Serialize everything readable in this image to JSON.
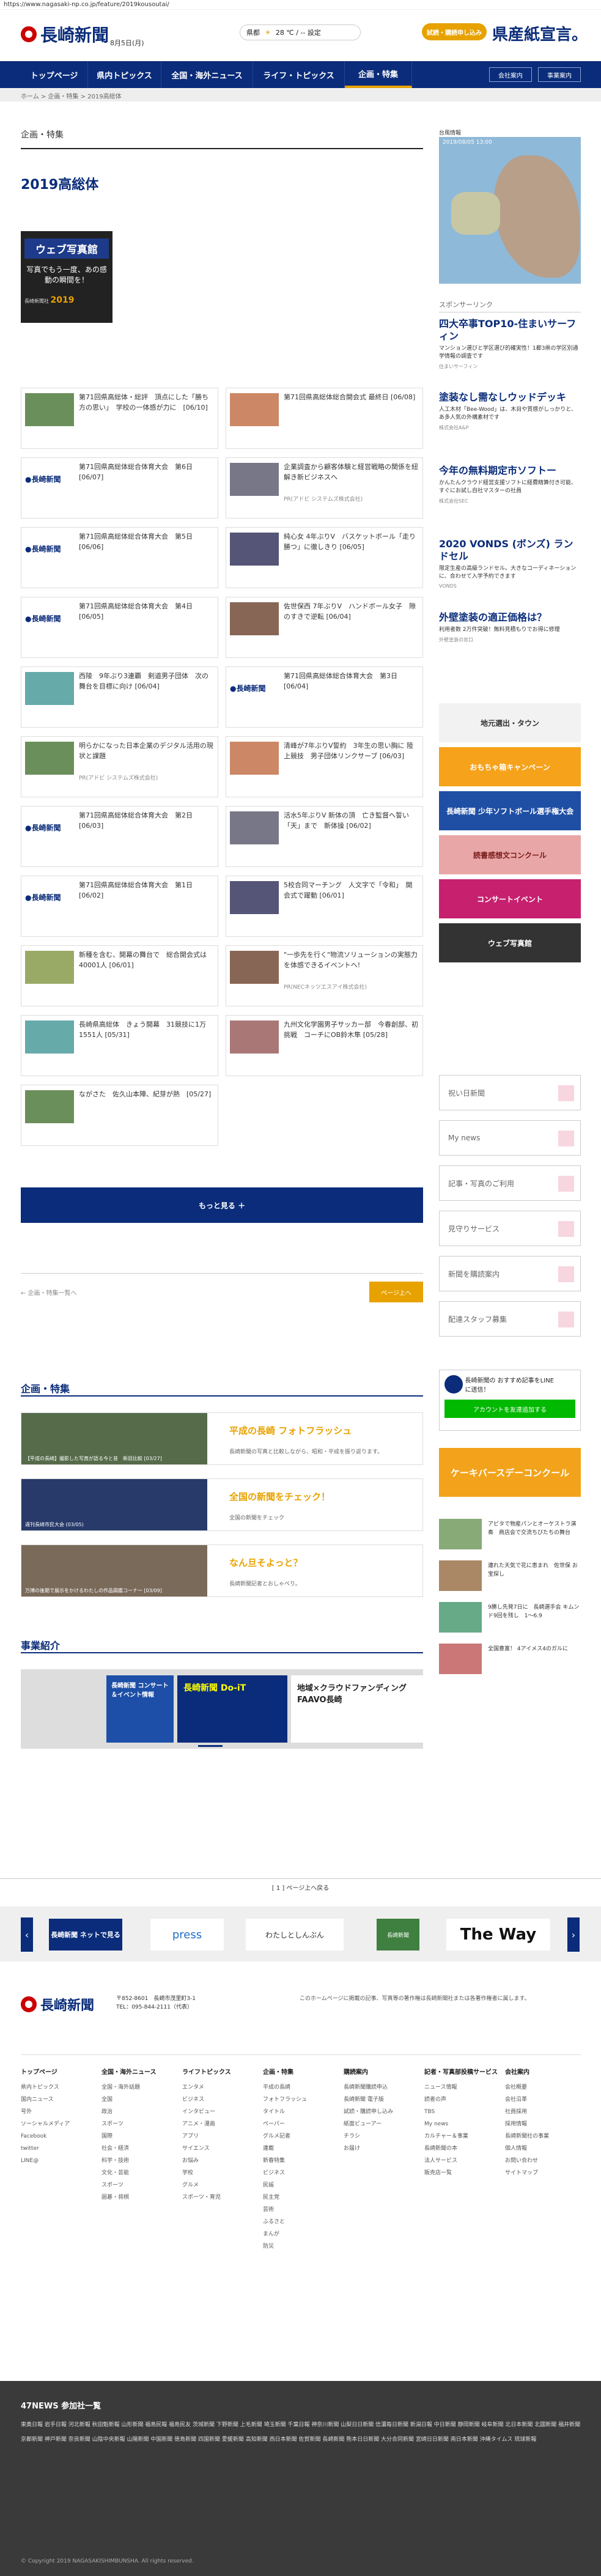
{
  "url": "https://www.nagasaki-np.co.jp/feature/2019kousoutai/",
  "header": {
    "logo": "長崎新聞",
    "date": "8月5日(月)",
    "weather_place": "県都",
    "weather_temp": "28 ℃ / -- 設定",
    "trial": "試読・購読申し込み",
    "slogan": "県産紙宣言。"
  },
  "nav": {
    "items": [
      "トップページ",
      "県内トピックス",
      "全国・海外ニュース",
      "ライフ・トピックス",
      "企画・特集"
    ],
    "company": "会社案内",
    "business": "事業案内"
  },
  "breadcrumb": "ホーム > 企画・特集 > 2019高総体",
  "page": {
    "section": "企画・特集",
    "title": "2019高総体"
  },
  "banner": {
    "title": "ウェブ写真館",
    "sub": "写真でもう一度、あの感動の瞬間を！",
    "year": "2019",
    "brand": "長崎新聞社"
  },
  "articles": [
    {
      "title": "第71回県高総体・総評　頂点にした「勝ち方の思い」　学校の一体感が力に　[06/10]",
      "pr": ""
    },
    {
      "title": "第71回県高総体総合開会式 最終日 [06/08]",
      "pr": ""
    },
    {
      "title": "第71回県高総体総合体育大会　第6日 [06/07]",
      "pr": ""
    },
    {
      "title": "企業調査から顧客体験と経営戦略の関係を紐解き新ビジネスへ",
      "pr": "PR(アドビ システムズ株式会社)"
    },
    {
      "title": "第71回県高総体総合体育大会　第5日 [06/06]",
      "pr": ""
    },
    {
      "title": "純心女 4年ぶりV　バスケットボール「走り勝つ」に徹しきり [06/05]",
      "pr": ""
    },
    {
      "title": "第71回県高総体総合体育大会　第4日 [06/05]",
      "pr": ""
    },
    {
      "title": "佐世保西 7年ぶりV　ハンドボール女子　隙のすきで逆転 [06/04]",
      "pr": ""
    },
    {
      "title": "西陵　9年ぶり3連覇　剣道男子団体　次の舞台を目標に向け [06/04]",
      "pr": ""
    },
    {
      "title": "第71回県高総体総合体育大会　第3日 [06/04]",
      "pr": ""
    },
    {
      "title": "明らかになった日本企業のデジタル活用の現状と課題",
      "pr": "PR(アドビ システムズ株式会社)"
    },
    {
      "title": "清峰が7年ぶりV誓約　3年生の思い胸に 陸上競技　男子団体リンクサーブ [06/03]",
      "pr": ""
    },
    {
      "title": "第71回県高総体総合体育大会　第2日 [06/03]",
      "pr": ""
    },
    {
      "title": "活水5年ぶりV 新体の頂　亡き監督へ誓い「天」まで　新体操 [06/02]",
      "pr": ""
    },
    {
      "title": "第71回県高総体総合体育大会　第1日 [06/02]",
      "pr": ""
    },
    {
      "title": "5校合同マーチング　人文字で「令和」　開会式で躍動 [06/01]",
      "pr": ""
    },
    {
      "title": "新種を含む、開幕の舞台で　総合開会式は40001人 [06/01]",
      "pr": ""
    },
    {
      "title": "\"一歩先を行く\"物流ソリューションの実態力を体感できるイベントへ!",
      "pr": "PR(NECネッツエスアイ株式会社)"
    },
    {
      "title": "長崎県高総体　きょう開幕　31競技に1万1551人 [05/31]",
      "pr": ""
    },
    {
      "title": "九州文化学園男子サッカー部　今春創部、初挑戦　コーチにOB鈴木隼 [05/28]",
      "pr": ""
    },
    {
      "title": "ながさた　佐久山本陣、紀芽が熱　[05/27]",
      "pr": ""
    }
  ],
  "more": "もっと見る ＋",
  "pager": {
    "prev": "← 企画・特集一覧へ",
    "next": "ページ上へ"
  },
  "features_title": "企画・特集",
  "features": [
    {
      "cap": "【平成の長崎】撮影した写真が語る今と昔　新旧比較 [03/27]",
      "title": "平成の長崎 フォトフラッシュ",
      "desc": "長崎新聞の写真と比較しながら、昭和・平成を振り返ります。"
    },
    {
      "cap": "週刊長崎市民大会 (03/05)",
      "title": "全国の新聞をチェック！",
      "desc": "全国の新聞をチェック"
    },
    {
      "cap": "万博の後期で展示をかけるわたしの作品図鑑コーナー [03/09]",
      "title": "なん旦そよっと？",
      "desc": "長崎新聞記者とおしゃべり。"
    }
  ],
  "projects_title": "事業紹介",
  "projects": [
    "長崎新聞 コンサート＆イベント情報",
    "長崎新聞 Do-iT",
    "地域×クラウドファンディング FAAVO長崎"
  ],
  "sidebar": {
    "map_title": "台風情報",
    "map_date": "2019/08/05 13:00",
    "sponsor_label": "スポンサーリンク",
    "sponsors": [
      {
        "h": "四大卒事TOP10-住まいサーフィン",
        "d": "マンション選びと学区選び的確実性！1都3県の学区別通学情報の調査です",
        "s": "住まいサーフィン"
      },
      {
        "h": "塗装なし需なしウッドデッキ",
        "d": "人工木材「Bee-Wood」は、木目や質感がしっかりと、あ多人気の外構素材です",
        "s": "株式会社A&P"
      },
      {
        "h": "今年の無料期定市ソフトー",
        "d": "かんたんクラウド経営支援ソフトに経費精算付き可能、すぐにお試し自社マスターの社員",
        "s": "株式会社SEC"
      },
      {
        "h": "2020 VONDS (ボンズ) ランドセル",
        "d": "限定生産の高級ランドセル。大きなコーディネーションに、合わせて入学予約できます",
        "s": "VONDS"
      },
      {
        "h": "外壁塗装の適正価格は？",
        "d": "利用者数 2万件突破！無料見積もりでお得に修理",
        "s": "外壁塗装の窓口"
      }
    ],
    "promos": [
      "地元選出・タウン",
      "おもちゃ箱キャンペーン",
      "長崎新聞 少年ソフトボール選手権大会",
      "読書感想文コンクール",
      "コンサートイベント",
      "ウェブ写真館"
    ],
    "buttons": [
      "祝い日新聞",
      "My news",
      "記事・写真のご利用",
      "見守りサービス",
      "新聞を購読案内",
      "配達スタッフ募集"
    ],
    "line": "長崎新聞の おすすめ記事をLINEに送信！",
    "line_btn": "アカウントを友達追加する",
    "promo2": "ケーキバースデーコンクール",
    "list": [
      {
        "t": "アピタで物産パンとオーケストラ演奏　商店会で交流ちびたちの舞台"
      },
      {
        "t": "連れた天気で花に恵まれ　佐世保 お宝探し"
      },
      {
        "t": "9勝し先発7日に　長崎選手会 キムンド9回を残し　1～6.9"
      },
      {
        "t": "全国豊富！ 4アイメス4のガルに"
      }
    ]
  },
  "footbar": "[ 1 ] ページ上へ戻る",
  "carousel": [
    "長崎新聞 ネットで見る",
    "press",
    "わたしとしんぶん",
    "長崎新聞",
    "The Way"
  ],
  "footer": {
    "address": "〒852-8601　長崎市茂里町3-1",
    "tel": "TEL：095-844-2111（代表）",
    "copy": "このホームページに掲載の記事、写真等の著作権は長崎新聞社または各著作権者に属します。",
    "cols": [
      {
        "h": "トップページ",
        "items": [
          "県内トピックス",
          "国内ニュース",
          "号外",
          "ソーシャルメディア",
          "Facebook",
          "twitter",
          "LINE@"
        ]
      },
      {
        "h": "全国・海外ニュース",
        "items": [
          "全国・海外話題",
          "全国",
          "政治",
          "スポーツ",
          "国際",
          "社会・経済",
          "科学・技術",
          "文化・芸能",
          "スポーツ",
          "囲碁・将棋"
        ]
      },
      {
        "h": "ライフトピックス",
        "items": [
          "エンタメ",
          "ビジネス",
          "インタビュー",
          "アニメ・漫画",
          "アプリ",
          "サイエンス",
          "お悩み",
          "学校",
          "グルメ",
          "スポーツ・育児"
        ]
      },
      {
        "h": "企画・特集",
        "items": [
          "平成の長崎",
          "フォトフラッシュ",
          "タイトル",
          "ペーパー",
          "グルメ記者",
          "連載",
          "新春特集",
          "ビジネス",
          "民謡",
          "民主党",
          "芸術",
          "ふるさと",
          "まんが",
          "防災"
        ]
      },
      {
        "h": "購読案内",
        "items": [
          "長崎新聞購読申込",
          "長崎新聞 電子版",
          "試読・購読申し込み",
          "紙面ビューアー",
          "チラシ",
          "お届け"
        ]
      },
      {
        "h": "記者・写真部投稿サービス",
        "items": [
          "ニュース情報",
          "読者の声",
          "TBS",
          "My news",
          "カルチャー＆事業",
          "長崎新聞の本",
          "法人サービス",
          "販売店一覧"
        ]
      },
      {
        "h": "会社案内",
        "items": [
          "会社概要",
          "会社沿革",
          "社員採用",
          "採用情報",
          "長崎新聞社の事業",
          "個人情報",
          "お問い合わせ",
          "サイトマップ"
        ]
      }
    ]
  },
  "network": {
    "title": "47NEWS 参加社一覧",
    "copyright": "© Copyright 2019 NAGASAKISHIMBUNSHA. All rights reserved."
  }
}
